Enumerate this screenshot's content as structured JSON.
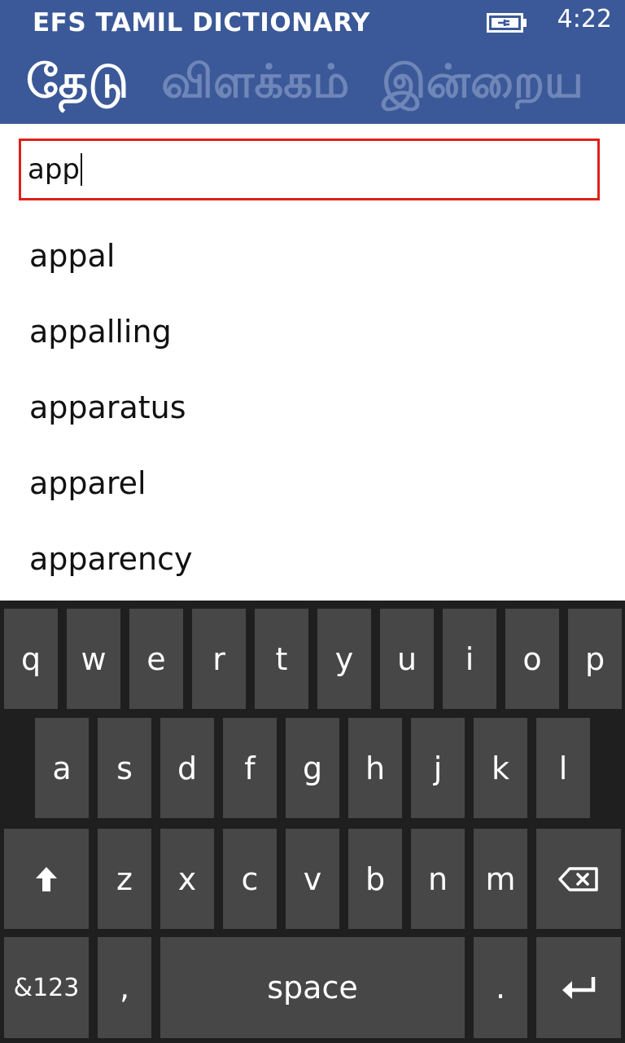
{
  "status_bar": {
    "time": "4:22",
    "battery_icon": "battery-charging-icon"
  },
  "header": {
    "app_title": "EFS TAMIL DICTIONARY",
    "tabs": [
      {
        "label": "தேடு",
        "active": true
      },
      {
        "label": "விளக்கம்",
        "active": false
      },
      {
        "label": "இன்றைய",
        "active": false
      }
    ]
  },
  "search": {
    "value": "app"
  },
  "suggestions": [
    "appal",
    "appalling",
    "apparatus",
    "apparel",
    "apparency"
  ],
  "keyboard": {
    "row1": [
      "q",
      "w",
      "e",
      "r",
      "t",
      "y",
      "u",
      "i",
      "o",
      "p"
    ],
    "row2": [
      "a",
      "s",
      "d",
      "f",
      "g",
      "h",
      "j",
      "k",
      "l"
    ],
    "row3": [
      "z",
      "x",
      "c",
      "v",
      "b",
      "n",
      "m"
    ],
    "symbols_label": "&123",
    "comma_label": ",",
    "space_label": "space",
    "period_label": ".",
    "shift_icon": "shift-arrow-icon",
    "backspace_icon": "backspace-icon",
    "enter_icon": "enter-icon"
  },
  "colors": {
    "header_bg": "#3b5998",
    "inactive_tab": "#6f86b8",
    "search_border": "#e0201a",
    "keyboard_bg": "#1f1f1f",
    "key_bg": "#474747"
  }
}
